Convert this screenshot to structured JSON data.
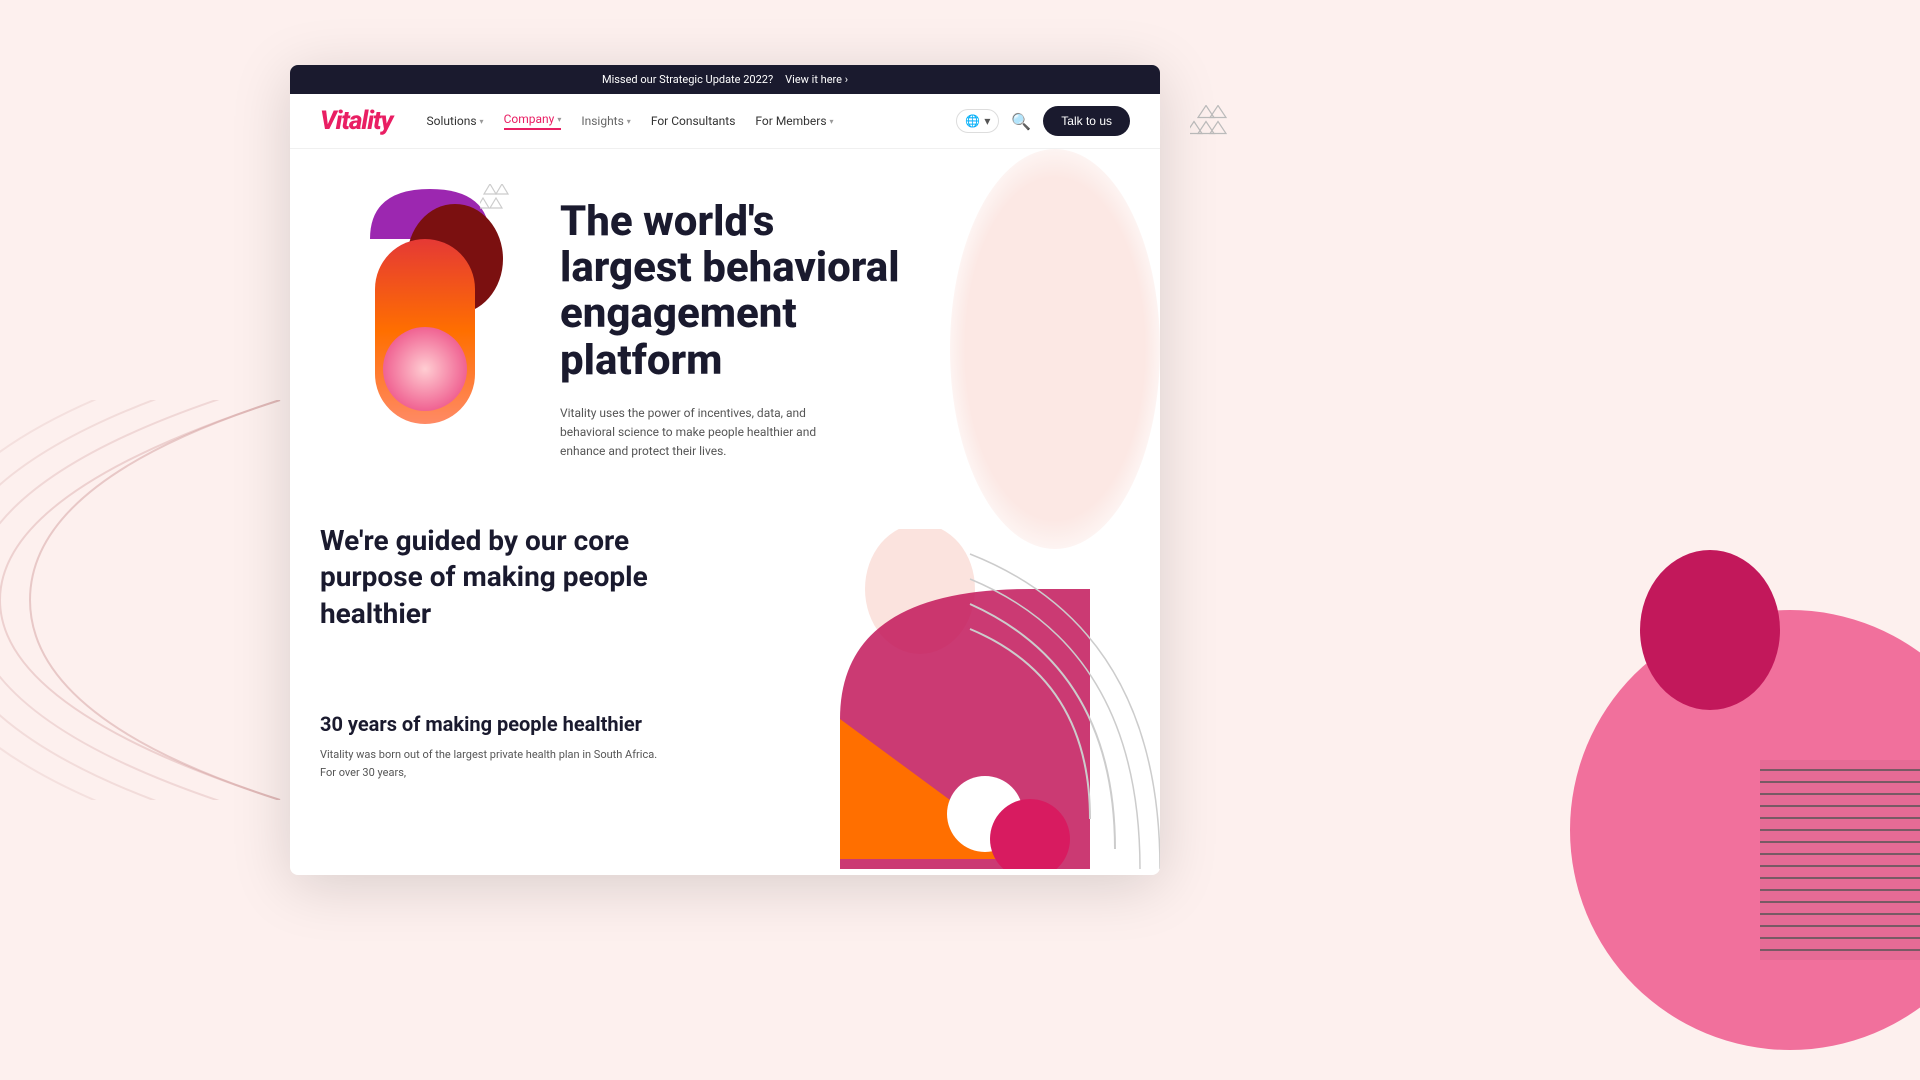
{
  "announcement": {
    "text": "Missed our Strategic Update 2022?",
    "link_text": "View it here ›"
  },
  "navbar": {
    "logo": "Vitality",
    "nav_items": [
      {
        "label": "Solutions",
        "has_dropdown": true,
        "active": false
      },
      {
        "label": "Company",
        "has_dropdown": true,
        "active": true
      },
      {
        "label": "Insights",
        "has_dropdown": true,
        "active": false
      },
      {
        "label": "For Consultants",
        "has_dropdown": false,
        "active": false
      },
      {
        "label": "For Members",
        "has_dropdown": true,
        "active": false
      }
    ],
    "globe_label": "🌐 ▾",
    "search_icon": "🔍",
    "talk_button": "Talk to us"
  },
  "hero": {
    "heading_line1": "The world's",
    "heading_line2": "largest behavioral",
    "heading_line3": "engagement",
    "heading_line4": "platform",
    "subtext": "Vitality uses the power of incentives, data, and behavioral science to make people healthier and enhance and protect their lives."
  },
  "core_purpose": {
    "heading": "We're guided by our core purpose of making people healthier"
  },
  "years_section": {
    "heading": "30 years of making people healthier",
    "text": "Vitality was born out of the largest private health plan in South Africa. For over 30 years,"
  }
}
